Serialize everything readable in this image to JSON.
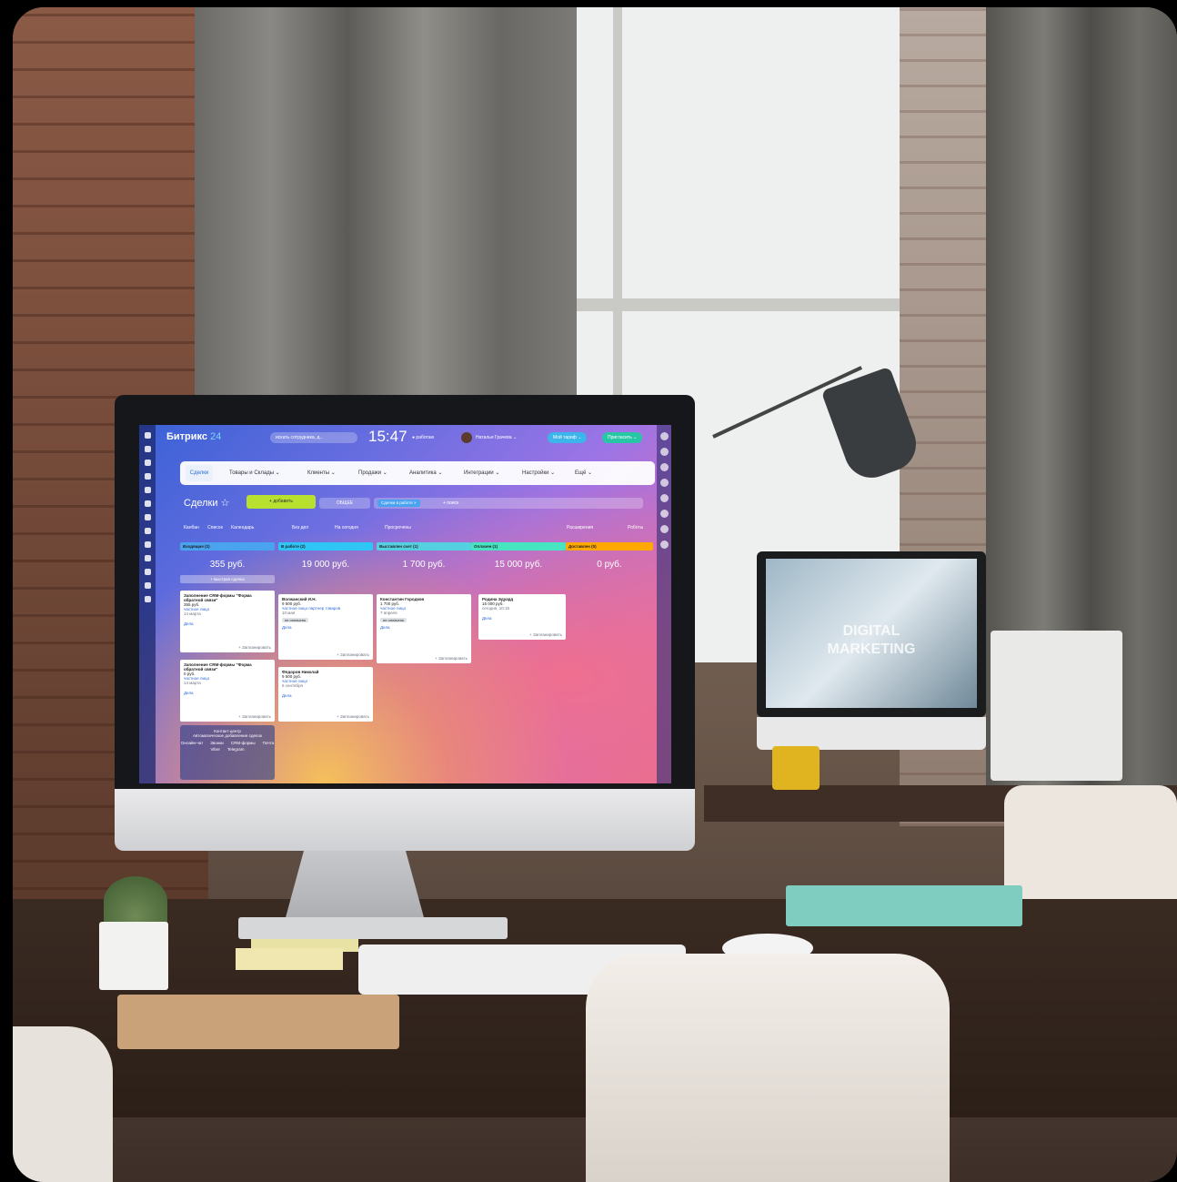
{
  "app": {
    "logo": "Битрикс",
    "logo_suffix": "24",
    "search_placeholder": "искать сотрудника, д...",
    "time": "15:47",
    "work_status": "● работаю",
    "user_name": "Наталья Грачева ⌄",
    "tariff_button": "Мой тариф ⌄",
    "invite_button": "Пригласить ⌄"
  },
  "menu": {
    "items": [
      "Сделки",
      "Товары и Склады ⌄",
      "Клиенты ⌄",
      "Продажи ⌄",
      "Аналитика ⌄",
      "Интеграции ⌄",
      "Настройки ⌄",
      "Ещё ⌄"
    ]
  },
  "toolbar": {
    "title": "Сделки ☆",
    "add_button": "+ добавить",
    "filter_label": "ОБЩЕЕ",
    "filter_chip": "Сделки в работе ×",
    "search_placeholder": "+ поиск"
  },
  "views": {
    "tabs": [
      "Канбан",
      "Список",
      "Календарь"
    ],
    "counters": [
      "Без дел",
      "На сегодня",
      "Просрочены"
    ],
    "extensions_button": "Расширения",
    "robots_button": "Роботы"
  },
  "columns": [
    {
      "name": "Входящие (2)",
      "sum": "355 руб.",
      "color": "#4aa3ef"
    },
    {
      "name": "В работе (2)",
      "sum": "19 000 руб.",
      "color": "#2fc6f6"
    },
    {
      "name": "Выставлен счет (1)",
      "sum": "1 700 руб.",
      "color": "#55d0e0"
    },
    {
      "name": "Оплачен (1)",
      "sum": "15 000 руб.",
      "color": "#47e4c2"
    },
    {
      "name": "Доставлен (0)",
      "sum": "0 руб.",
      "color": "#ffa900"
    }
  ],
  "quick_deal": "+ Быстрая сделка",
  "cards": [
    {
      "title": "Заполнение CRM-формы \"Форма обратной связи\"",
      "amount": "355 руб.",
      "client": "частное лицо",
      "date": "14 марта",
      "activity": "Дела",
      "plan": "+ Запланировать"
    },
    {
      "title": "Заполнение CRM-формы \"Форма обратной связи\"",
      "amount": "0 руб.",
      "client": "частное лицо",
      "date": "14 марта",
      "activity": "Дела",
      "plan": "+ Запланировать"
    },
    {
      "title": "Волжанский И.Н.",
      "amount": "9 500 руб.",
      "client": "частное лицо партнер товаров",
      "date": "10 мая",
      "badge": "не оплачено",
      "activity": "Дела",
      "plan": "+ Запланировать"
    },
    {
      "title": "Федоров Николай",
      "amount": "9 500 руб.",
      "client": "частное лицо",
      "date": "6 сентября",
      "activity": "Дела",
      "plan": "+ Запланировать"
    },
    {
      "title": "Константин Городков",
      "amount": "1 700 руб.",
      "client": "частное лицо",
      "date": "7 апреля",
      "badge": "не оплачено",
      "activity": "Дела",
      "plan": "+ Запланировать"
    },
    {
      "title": "Родина Эдуард",
      "amount": "15 000 руб.",
      "client": "",
      "date": "сегодня, 10:15",
      "activity": "Дела",
      "plan": "+ Запланировать"
    }
  ],
  "contact_center": {
    "title": "Контакт-центр",
    "subtitle": "Автоматическое добавление сделок",
    "channels": [
      "Онлайн-чат",
      "Звонки",
      "CRM-формы",
      "Почта",
      "Viber",
      "Telegram"
    ]
  },
  "second_monitor_text": [
    "DIGITAL",
    "MARKETING"
  ]
}
